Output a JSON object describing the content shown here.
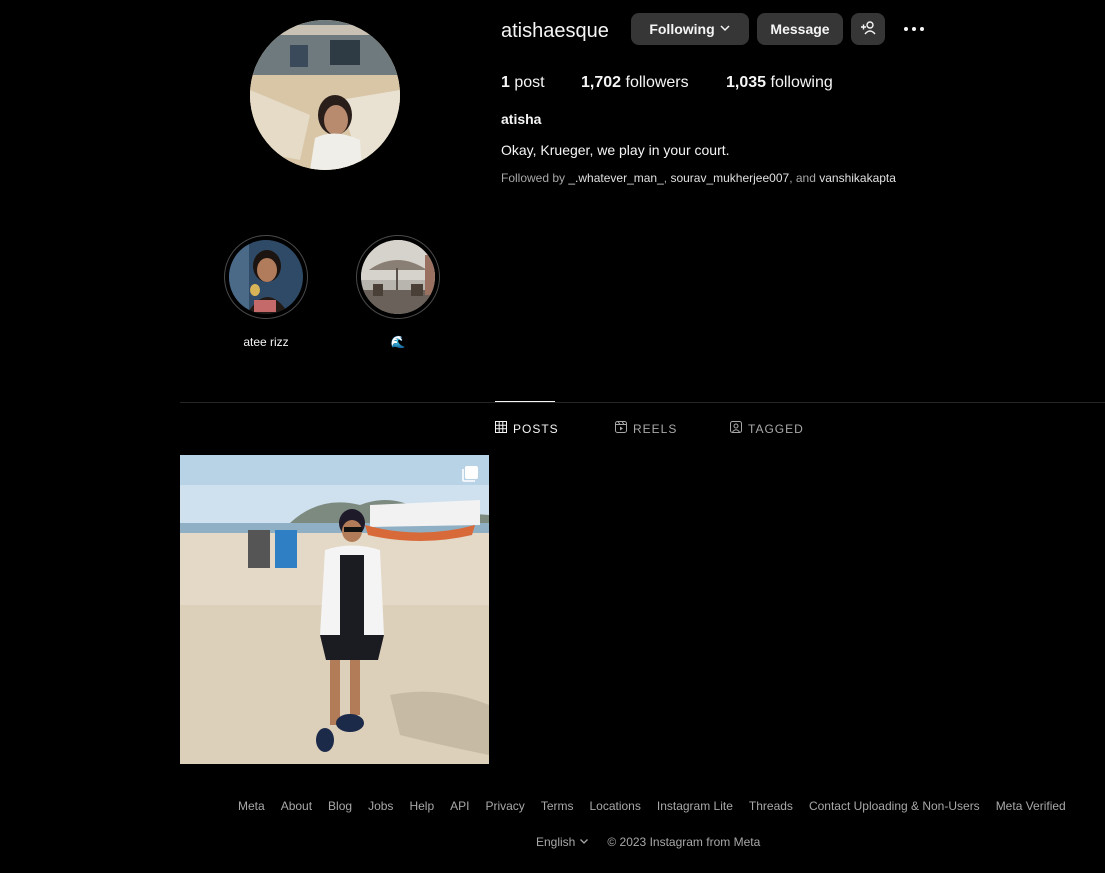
{
  "profile": {
    "username": "atishaesque",
    "full_name": "atisha",
    "bio": "Okay, Krueger, we play in your court.",
    "followed_by_prefix": "Followed by ",
    "followed_by_users": [
      "_.whatever_man_",
      "sourav_mukherjee007",
      "vanshikakapta"
    ],
    "followed_by_sep1": ", ",
    "followed_by_sep2": ", and "
  },
  "buttons": {
    "following": "Following",
    "message": "Message"
  },
  "stats": {
    "posts_count": "1",
    "posts_label": " post",
    "followers_count": "1,702",
    "followers_label": " followers",
    "following_count": "1,035",
    "following_label": " following"
  },
  "highlights": [
    {
      "label": "atee rizz"
    },
    {
      "label": "🌊"
    }
  ],
  "tabs": [
    {
      "label": "POSTS",
      "icon": "grid-icon",
      "active": true
    },
    {
      "label": "REELS",
      "icon": "reels-icon",
      "active": false
    },
    {
      "label": "TAGGED",
      "icon": "tagged-icon",
      "active": false
    }
  ],
  "footer": {
    "links": [
      "Meta",
      "About",
      "Blog",
      "Jobs",
      "Help",
      "API",
      "Privacy",
      "Terms",
      "Locations",
      "Instagram Lite",
      "Threads",
      "Contact Uploading & Non-Users",
      "Meta Verified"
    ],
    "language": "English",
    "copyright": "© 2023 Instagram from Meta"
  },
  "colors": {
    "background": "#000000",
    "button_bg": "#363636",
    "text_primary": "#f5f5f5",
    "text_secondary": "#a8a8a8",
    "divider": "#262626"
  }
}
